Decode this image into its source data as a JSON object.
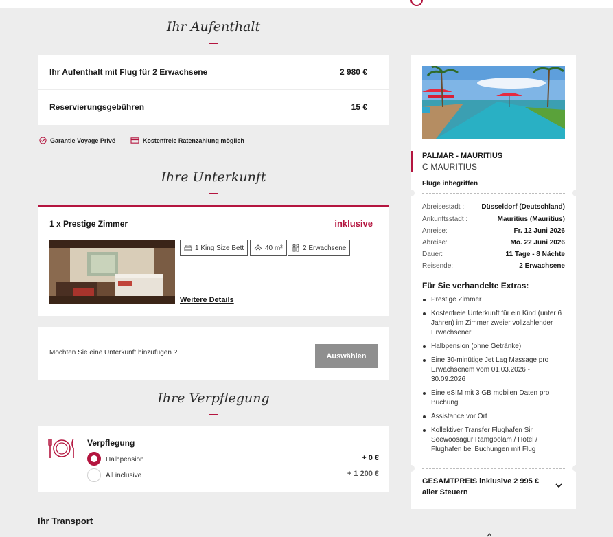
{
  "sections": {
    "stay_title": "Ihr Aufenthalt",
    "accommodation_title": "Ihre Unterkunft",
    "catering_title": "Ihre Verpflegung",
    "transport_title": "Ihr Transport"
  },
  "stay": {
    "rows": [
      {
        "label": "Ihr Aufenthalt mit Flug für 2 Erwachsene",
        "price": "2 980 €"
      },
      {
        "label": "Reservierungsgebühren",
        "price": "15 €"
      }
    ],
    "guarantee_label": "Garantie Voyage Privé",
    "installment_label": "Kostenfreie Ratenzahlung möglich"
  },
  "room": {
    "title": "1 x Prestige Zimmer",
    "status": "inklusive",
    "bed": "1 King Size Bett",
    "area": "40 m²",
    "guests": "2 Erwachsene",
    "details_link": "Weitere Details"
  },
  "add_accommodation": {
    "question": "Möchten Sie eine Unterkunft hinzufügen ?",
    "button": "Auswählen"
  },
  "catering": {
    "title": "Verpflegung",
    "options": [
      {
        "label": "Halbpension",
        "price": "+ 0 €",
        "selected": true
      },
      {
        "label": "All inclusive",
        "price": "+ 1 200 €",
        "selected": false
      }
    ]
  },
  "sidebar": {
    "hotel_name": "PALMAR - MAURITIUS",
    "hotel_sub": "C MAURITIUS",
    "flights_label": "Flüge inbegriffen",
    "info": [
      {
        "key": "Abreisestadt :",
        "value": "Düsseldorf (Deutschland)"
      },
      {
        "key": "Ankunftsstadt :",
        "value": "Mauritius (Mauritius)"
      },
      {
        "key": "Anreise:",
        "value": "Fr. 12 Juni 2026"
      },
      {
        "key": "Abreise:",
        "value": "Mo. 22 Juni 2026"
      },
      {
        "key": "Dauer:",
        "value": "11 Tage - 8 Nächte"
      },
      {
        "key": "Reisende:",
        "value": "2 Erwachsene"
      }
    ],
    "extras_title": "Für Sie verhandelte Extras:",
    "extras": [
      "Prestige Zimmer",
      "Kostenfreie Unterkunft für ein Kind (unter 6 Jahren) im Zimmer zweier vollzahlender Erwachsener",
      "Halbpension (ohne Getränke)",
      "Eine 30-minütige Jet Lag Massage pro Erwachsenem vom 01.03.2026 - 30.09.2026",
      "Eine eSIM mit 3 GB mobilen Daten pro Buchung",
      "Assistance vor Ort",
      "Kollektiver Transfer Flughafen Sir Seewoosagur Ramgoolam / Hotel / Flughafen bei Buchungen mit Flug"
    ],
    "total": "GESAMTPREIS inklusive 2 995 € aller Steuern"
  },
  "colors": {
    "accent": "#b4153f",
    "background": "#ededed",
    "button_grey": "#8f8f8f"
  },
  "icons": [
    "shield-check-icon",
    "credit-card-icon",
    "bed-icon",
    "area-icon",
    "people-icon",
    "plate-cutlery-icon",
    "chevron-down-icon"
  ]
}
